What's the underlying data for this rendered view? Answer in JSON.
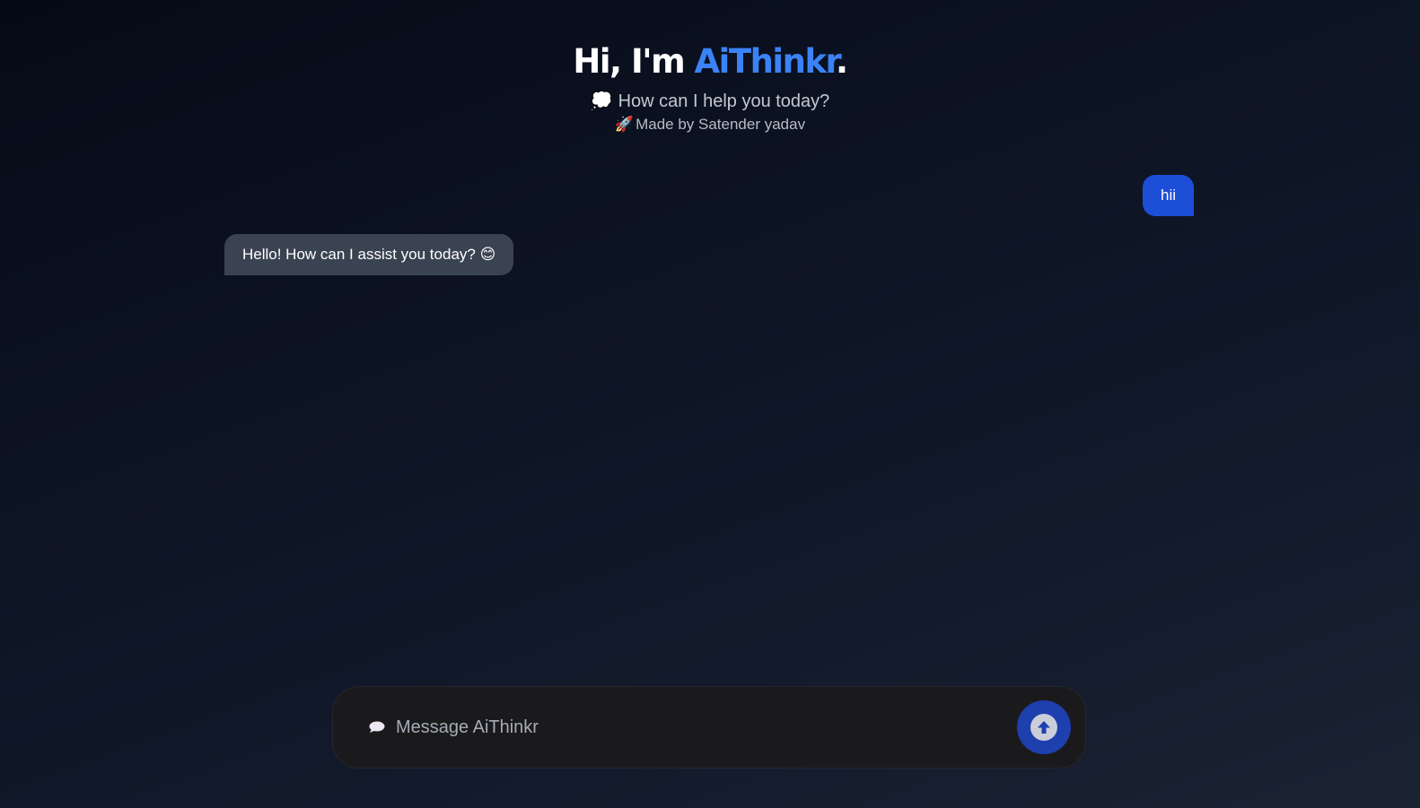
{
  "header": {
    "title_prefix": "Hi, I'm ",
    "title_brand": "AiThinkr",
    "title_suffix": ".",
    "subtitle_emoji": "💭",
    "subtitle": "How can I help you today?",
    "credit_emoji": "🚀",
    "credit": "Made by Satender yadav"
  },
  "messages": [
    {
      "role": "user",
      "text": "hii"
    },
    {
      "role": "bot",
      "text": "Hello! How can I assist you today?",
      "emoji": "😊"
    }
  ],
  "composer": {
    "icon": "speech-bubble-icon",
    "placeholder": "Message AiThinkr",
    "value": "",
    "send_icon": "arrow-up-icon"
  },
  "colors": {
    "brand": "#3b82f6",
    "user_bubble": "#1d4ed8",
    "bot_bubble": "#3a4352",
    "send_button": "#1e3fae"
  }
}
